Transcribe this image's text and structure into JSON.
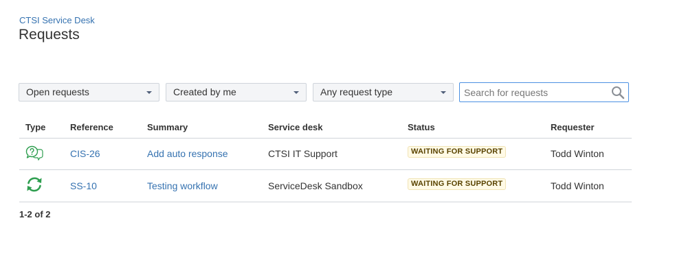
{
  "header": {
    "breadcrumb": "CTSI Service Desk",
    "title": "Requests"
  },
  "filters": {
    "status": "Open requests",
    "creator": "Created by me",
    "request_type": "Any request type",
    "search_placeholder": "Search for requests",
    "search_value": ""
  },
  "table": {
    "headers": {
      "type": "Type",
      "reference": "Reference",
      "summary": "Summary",
      "service_desk": "Service desk",
      "status": "Status",
      "requester": "Requester"
    },
    "rows": [
      {
        "type_icon": "question-chat-icon",
        "reference": "CIS-26",
        "summary": "Add auto response",
        "service_desk": "CTSI IT Support",
        "status": "WAITING FOR SUPPORT",
        "requester": "Todd Winton"
      },
      {
        "type_icon": "refresh-cycle-icon",
        "reference": "SS-10",
        "summary": "Testing workflow",
        "service_desk": "ServiceDesk Sandbox",
        "status": "WAITING FOR SUPPORT",
        "requester": "Todd Winton"
      }
    ]
  },
  "pagination": {
    "summary": "1-2 of 2"
  },
  "colors": {
    "link": "#3572b0",
    "icon_green": "#2e9e4f",
    "status_text": "#594300",
    "status_bg": "#fffae6"
  }
}
